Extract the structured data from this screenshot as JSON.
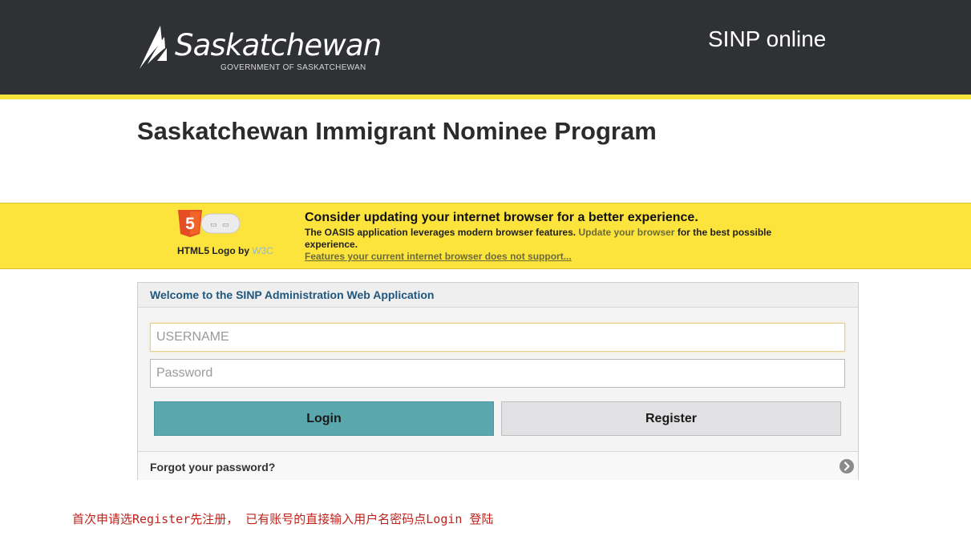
{
  "header": {
    "logo_word": "Saskatchewan",
    "logo_sub": "GOVERNMENT OF SASKATCHEWAN",
    "app_name": "SINP online",
    "background_color": "#2f3134",
    "stripe_color": "#f6e33b"
  },
  "page": {
    "title": "Saskatchewan Immigrant Nominee Program"
  },
  "browser_notice": {
    "badge_icon": "html5-logo-icon",
    "badge_number": "5",
    "credit_prefix": "HTML5 Logo by",
    "credit_link": "W3C",
    "title": "Consider updating your internet browser for a better experience.",
    "body_prefix": "The OASIS application leverages modern browser features.",
    "body_link": "Update your browser",
    "body_suffix": "for the best possible experience.",
    "features_link": "Features your current internet browser does not support...",
    "background_color": "#fde43d"
  },
  "login": {
    "panel_title": "Welcome to the SINP Administration Web Application",
    "username_placeholder": "USERNAME",
    "username_value": "",
    "password_placeholder": "Password",
    "password_value": "",
    "login_label": "Login",
    "register_label": "Register",
    "forgot_label": "Forgot your password?",
    "forgot_icon": "chevron-right-circle-icon",
    "login_color": "#5aa8ae",
    "title_color": "#20577d"
  },
  "annotation": {
    "text": "首次申请选Register先注册， 已有账号的直接输入用户名密码点Login 登陆",
    "color": "#c0221b"
  }
}
